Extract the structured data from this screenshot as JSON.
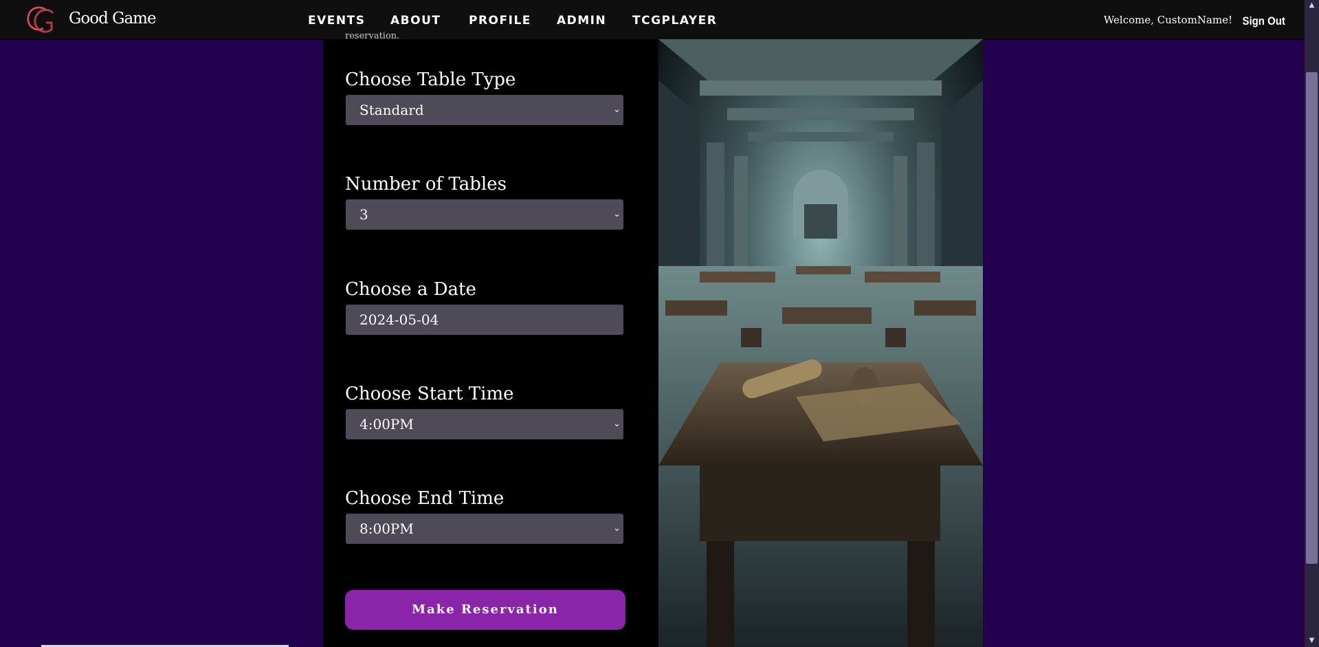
{
  "nav": {
    "brand": "Good Game",
    "links": [
      "EVENTS",
      "ABOUT",
      "PROFILE",
      "ADMIN",
      "TCGPLAYER"
    ],
    "welcome": "Welcome, CustomName!",
    "sign_out": "Sign Out"
  },
  "form": {
    "cut_off_text": "reservation.",
    "table_type": {
      "label": "Choose Table Type",
      "value": "Standard"
    },
    "num_tables": {
      "label": "Number of Tables",
      "value": "3"
    },
    "date": {
      "label": "Choose a Date",
      "value": "2024-05-04"
    },
    "start_time": {
      "label": "Choose Start Time",
      "value": "4:00PM"
    },
    "end_time": {
      "label": "Choose End Time",
      "value": "8:00PM"
    },
    "submit_label": "Make Reservation"
  },
  "icons": {
    "logo": "gg-monogram-icon",
    "dropdown": "chevron-down-icon",
    "scroll_up": "scroll-up-arrow-icon",
    "scroll_down": "scroll-down-arrow-icon"
  },
  "colors": {
    "page_background": "#23004e",
    "navbar": "#0f0f0f",
    "input_background": "#4f4a57",
    "button": "#8a24a8",
    "logo_accent": "#b23a44"
  }
}
